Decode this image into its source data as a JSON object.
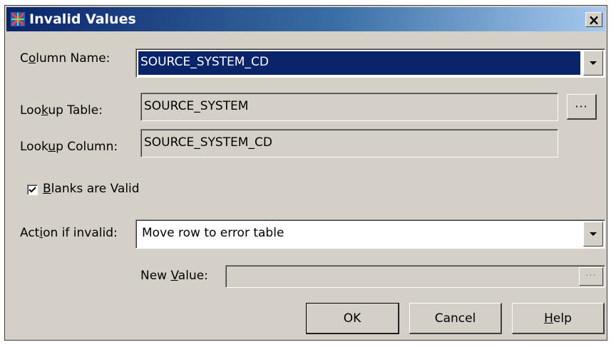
{
  "window": {
    "title": "Invalid Values",
    "close_glyph": "×"
  },
  "column_name": {
    "label_pre": "C",
    "label_key": "o",
    "label_post": "lumn Name:",
    "value": "SOURCE_SYSTEM_CD"
  },
  "lookup_table": {
    "label_pre": "Loo",
    "label_key": "k",
    "label_post": "up Table:",
    "value": "SOURCE_SYSTEM",
    "browse_label": "···"
  },
  "lookup_column": {
    "label_pre": "Look",
    "label_key": "u",
    "label_post": "p Column:",
    "value": "SOURCE_SYSTEM_CD"
  },
  "blanks_valid": {
    "label_key": "B",
    "label_post": "lanks are Valid",
    "checked": true
  },
  "action_if_invalid": {
    "label_pre": "Act",
    "label_key": "i",
    "label_post": "on if invalid:",
    "value": "Move row to error table"
  },
  "new_value": {
    "label_pre": "New ",
    "label_key": "V",
    "label_post": "alue:",
    "value": "",
    "browse_label": "···"
  },
  "buttons": {
    "ok": "OK",
    "cancel": "Cancel",
    "help_key": "H",
    "help_post": "elp"
  },
  "icons": {
    "title": "sas-app-icon",
    "dropdown": "chevron-down-icon",
    "checkmark": "checkmark-icon"
  }
}
